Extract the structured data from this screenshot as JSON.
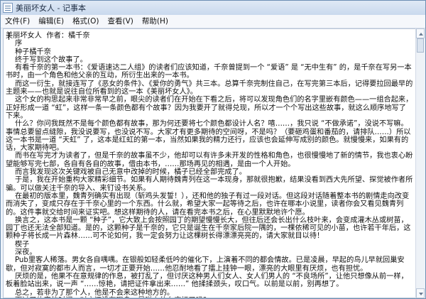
{
  "window": {
    "title": "美丽坏女人 - 记事本"
  },
  "menu": {
    "items": [
      "文件(F)",
      "编辑(E)",
      "格式(O)",
      "查看(V)",
      "帮助(H)"
    ]
  },
  "editor": {
    "text": "美丽坏女人  作者：橘千奈\n    序\n    种子橘千奈\n    终于写到这个故事了。\n    有看千奈的第一本书：《爱语速达二人组》的读者们应该知道，千奈曾提到一个 “爱语” 是 “无中生有” 的，是千奈在写另一本书时，由一个角色和他父亲的互动，所衍生出来的一本书。\n    而这一衍生，就接连写了《恶女的条件》、《爱你的勇气》共三本。总算千奈完制住自己，在写完第三本后，记得要拉回最早的主题来——也就是说往自位所看到的这一本《美丽坏女人》。\n    这个女的构思起来非常非常早之前，眼尖的读者们在开始在下看之后，将可以发现角色们的名字里嵌有颜色——一组合起来，正好形成一道 “虹”，这样一条一条颜色都有个故事？因为我要开了就得兑现，所以才一个个写出这些故事，就这么顺序地写了下来。\n    什么？你问我既然不是每个颜色都有故事，那为何还要将七个颜色都设计人名？嘻……，我只说 “不做承诺”，没说不写嘛。事情总要留点缝隙，我没说要写，也没说不写。大家才有更多期待的空间呀，不是吗？（要砸鸡蛋和番茄的，请排队……）所以这一本书是一道 “天虹” 了，这本是红虹的第一本，当然如果我的精力还行，应该也会延伸写成别的颜色。就慢慢来，如果有的话，大家期待吧。\n    而书在写完才为读者了，但是千奈的故事虽不少，他却可以有许多未开发的性格和角色，也很慢慢地了新的情节，我也衷心盼望能够写完七部，各自有各自的故事，借由本书，……那场再见的相遇，是由一个人开始。\n    而言我发现这次关键戏被自己无意中改掉的时候，橘子已经全部完成了。\n    于是，我在开始重构大家精彩细节。如果有人期待魏青列在这一本现身，那就很抱歉，结果没看到西大先所望、探觉被作者所骗。可以做关注千奈的导入、来钉设书关系。\n    在最初的版本里，魏青列确实有出现（斩鸡头发誓！），还和他的独子有过一段对话。但这段对话随着整本书的剧情走向改变而消失了，变成只存在于千奈心里的一个东西。什么就，希望大家一起等待之后，也许在哪本小说里，读者你会又看见魏青列的。这件事就交给时间来证实吧。想这样期待的人，请在看完本书之后，在心里默默地许个愿。\n    换言之，这本书是一颗 “种子”，它大致上会按照园丁的期望慢慢长大，但往后还会长出什么枝叶来，会变成灌木丛或树苗，园丁也还无法全部知道。是的，这颗种子是千奈的，它只是诞生在千奈家后院一隅的，一棵依稀可见的小苗，也许若干年后，这颗种子将长成一片森林……可不论如何，我一定会努力让这棵树长得漂漂亮亮的，请大家就目以待！\n    楔子\n    深夜。\n    Pub里客人稀落。男女各自喁喁。在银般如轻柔低吟的催化下，上演着不同的都会情故。已是凌晨，早起的鸟儿早就回巢安歇，但对寂寞的都市人而言，一切才正要开始……他忍耐地看了擂上挂钟一眼，漂亮的大眼里有厌烦，也有担忧。\n    厌烦的是，他果不在意规律的作息，被打乱了，但讨厌这种男人们女人、女人们男人的 “不良场所”，让他只想像从前一样，板着脸站出来，说一声 “……惊艳，请把证件拿出来……” 他揉揉颈头，叹口气。以前是以前，别再想了。\n    总之，若非为了那个人，他是不会来这种地方的。\n    而过了约定的时间，对方还没有现身，是碰上什么麻烦了吗？"
  }
}
